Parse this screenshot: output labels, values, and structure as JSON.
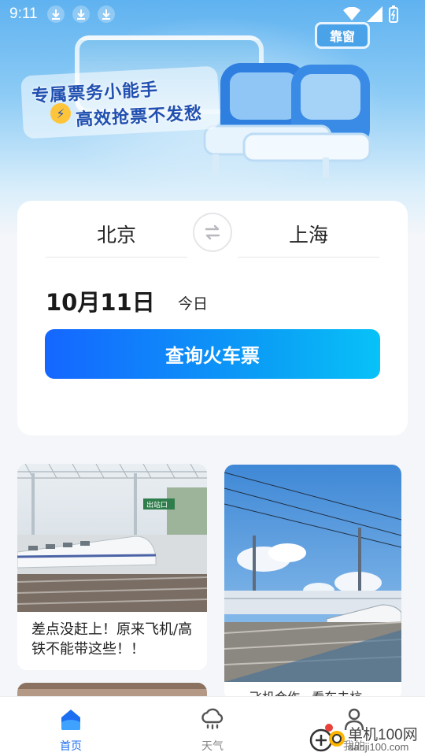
{
  "status_bar": {
    "time": "9:11"
  },
  "banner": {
    "line1": "专属票务小能手",
    "line2": "高效抢票不发愁",
    "seat_tag": "靠窗"
  },
  "search": {
    "from_city": "北京",
    "to_city": "上海",
    "date": "10月11日",
    "day_label": "今日",
    "query_button": "查询火车票"
  },
  "feed": {
    "items": [
      {
        "title": "差点没赶上！原来飞机/高铁不能带这些！！"
      },
      {
        "title": "…飞机合作 · 看车去杭"
      }
    ],
    "sign_text": "出站口"
  },
  "tab_bar": {
    "items": [
      {
        "label": "首页",
        "active": true,
        "icon": "home-icon"
      },
      {
        "label": "天气",
        "active": false,
        "icon": "weather-icon"
      },
      {
        "label": "我的",
        "active": false,
        "icon": "profile-icon"
      }
    ]
  },
  "watermark": {
    "text": "单机100网",
    "url": "danji100.com"
  },
  "colors": {
    "accent": "#1d6ff2",
    "button_start": "#1566ff",
    "button_end": "#08c2f8"
  }
}
